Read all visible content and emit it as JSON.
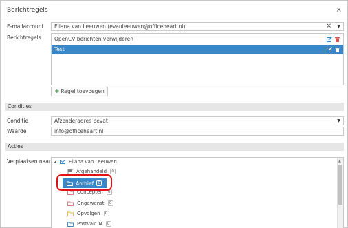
{
  "dialog": {
    "title": "Berichtregels",
    "close_icon": "×"
  },
  "form": {
    "email_label": "E-mailaccount",
    "email_value": "Eliana van Leeuwen (evanleeuwen@officeheart.nl)",
    "rules_label": "Berichtregels",
    "rules": [
      {
        "label": "OpenCV berichten verwijderen",
        "selected": false
      },
      {
        "label": "Test",
        "selected": true
      }
    ],
    "add_rule_label": "Regel toevoegen"
  },
  "conditions": {
    "section_title": "Condities",
    "condition_label": "Conditie",
    "condition_value": "Afzenderadres bevat",
    "value_label": "Waarde",
    "value_value": "info@officeheart.nl"
  },
  "actions": {
    "section_title": "Acties",
    "move_label": "Verplaatsen naar",
    "root_name": "Eliana van Leeuwen",
    "folders": [
      {
        "name": "Afgehandeld",
        "count": "0"
      },
      {
        "name": "Archief",
        "count": "0"
      },
      {
        "name": "Concepten",
        "count": "0"
      },
      {
        "name": "Ongewenst",
        "count": "0"
      },
      {
        "name": "Opvolgen",
        "count": "0"
      },
      {
        "name": "Postvak IN",
        "count": "0"
      }
    ]
  },
  "colors": {
    "accent": "#3a87c8",
    "highlight_ring": "#e0131a",
    "delete_red": "#d9534f",
    "add_green": "#3c9c3c"
  }
}
